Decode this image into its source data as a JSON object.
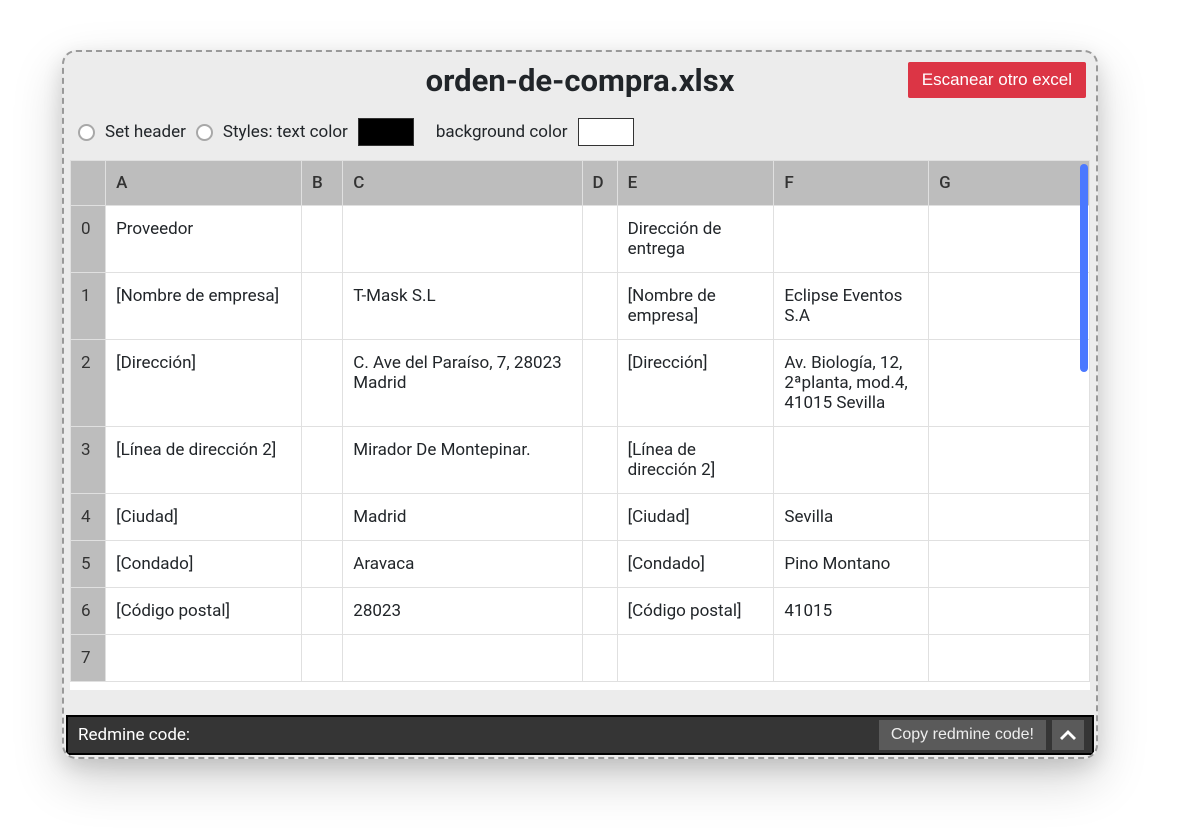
{
  "title": "orden-de-compra.xlsx",
  "scan_button": "Escanear otro excel",
  "controls": {
    "set_header": "Set header",
    "styles_label": "Styles: text color",
    "bg_label": "background color",
    "text_color": "#000000",
    "bg_color": "#ffffff"
  },
  "columns": [
    "A",
    "B",
    "C",
    "D",
    "E",
    "F",
    "G"
  ],
  "rows": [
    {
      "i": "0",
      "cells": [
        "Proveedor",
        "",
        "",
        "",
        "Dirección de entrega",
        "",
        ""
      ]
    },
    {
      "i": "1",
      "cells": [
        "[Nombre de empresa]",
        "",
        "T-Mask S.L",
        "",
        "[Nombre de empresa]",
        "Eclipse Eventos S.A",
        ""
      ]
    },
    {
      "i": "2",
      "cells": [
        "[Dirección]",
        "",
        "C. Ave del Paraíso, 7, 28023 Madrid",
        "",
        "[Dirección]",
        "Av. Biología, 12, 2ªplanta, mod.4, 41015 Sevilla",
        ""
      ]
    },
    {
      "i": "3",
      "cells": [
        "[Línea de dirección 2]",
        "",
        "Mirador De Montepinar.",
        "",
        "[Línea de dirección 2]",
        "",
        ""
      ]
    },
    {
      "i": "4",
      "cells": [
        "[Ciudad]",
        "",
        "Madrid",
        "",
        "[Ciudad]",
        "Sevilla",
        ""
      ]
    },
    {
      "i": "5",
      "cells": [
        "[Condado]",
        "",
        "Aravaca",
        "",
        "[Condado]",
        "Pino Montano",
        ""
      ]
    },
    {
      "i": "6",
      "cells": [
        "[Código postal]",
        "",
        "28023",
        "",
        "[Código postal]",
        "41015",
        ""
      ]
    },
    {
      "i": "7",
      "cells": [
        "",
        "",
        "",
        "",
        "",
        "",
        ""
      ]
    }
  ],
  "footer": {
    "label": "Redmine code:",
    "copy_button": "Copy redmine code!"
  }
}
